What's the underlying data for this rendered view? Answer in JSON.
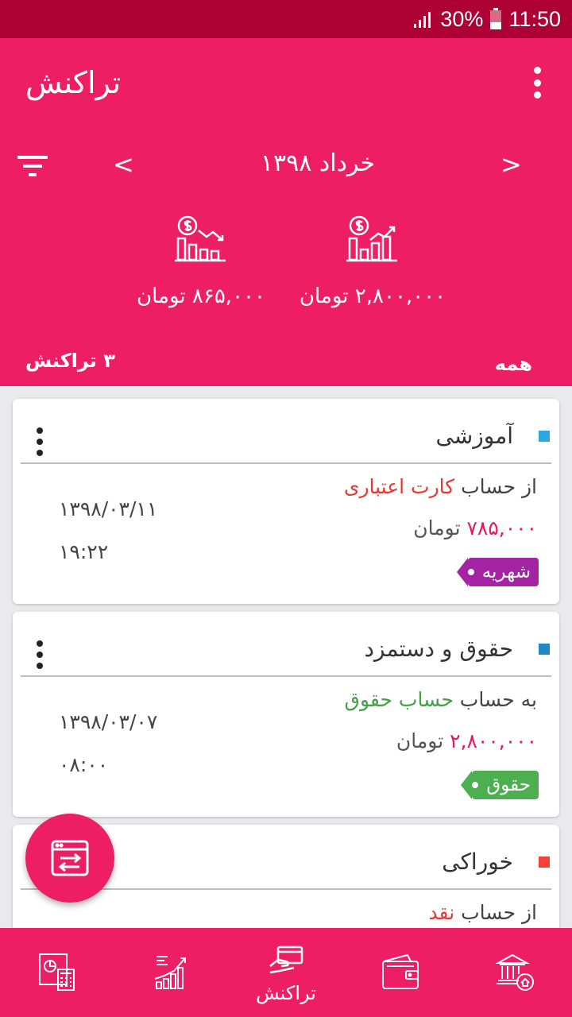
{
  "status_bar": {
    "battery": "30%",
    "time": "11:50"
  },
  "header": {
    "title": "تراکنش",
    "nav_prev": "<",
    "nav_next": ">",
    "month": "خرداد ۱۳۹۸",
    "expense_total": "۸۶۵,۰۰۰ تومان",
    "income_total": "۲,۸۰۰,۰۰۰ تومان",
    "count": "۳ تراکنش",
    "filter_all": "همه"
  },
  "transactions": [
    {
      "category": "آموزشی",
      "category_color": "#29a9e0",
      "direction": "از حساب",
      "account": "کارت اعتباری",
      "account_color": "#e53935",
      "amount": "۷۸۵,۰۰۰",
      "currency": "تومان",
      "date": "۱۳۹۸/۰۳/۱۱",
      "time": "۱۹:۲۲",
      "tag": "شهریه",
      "tag_color": "#a323a3"
    },
    {
      "category": "حقوق و دستمزد",
      "category_color": "#1e88c8",
      "direction": "به حساب",
      "account": "حساب حقوق",
      "account_color": "#43a047",
      "amount": "۲,۸۰۰,۰۰۰",
      "currency": "تومان",
      "date": "۱۳۹۸/۰۳/۰۷",
      "time": "۰۸:۰۰",
      "tag": "حقوق",
      "tag_color": "#4caf50"
    },
    {
      "category": "خوراکی",
      "category_color": "#f44336",
      "direction": "از حساب",
      "account": "نقد",
      "account_color": "#e53935"
    }
  ],
  "bottom_nav": {
    "active_label": "تراکنش"
  },
  "colors": {
    "primary": "#ed1e64",
    "status_bar": "#ad0034"
  }
}
